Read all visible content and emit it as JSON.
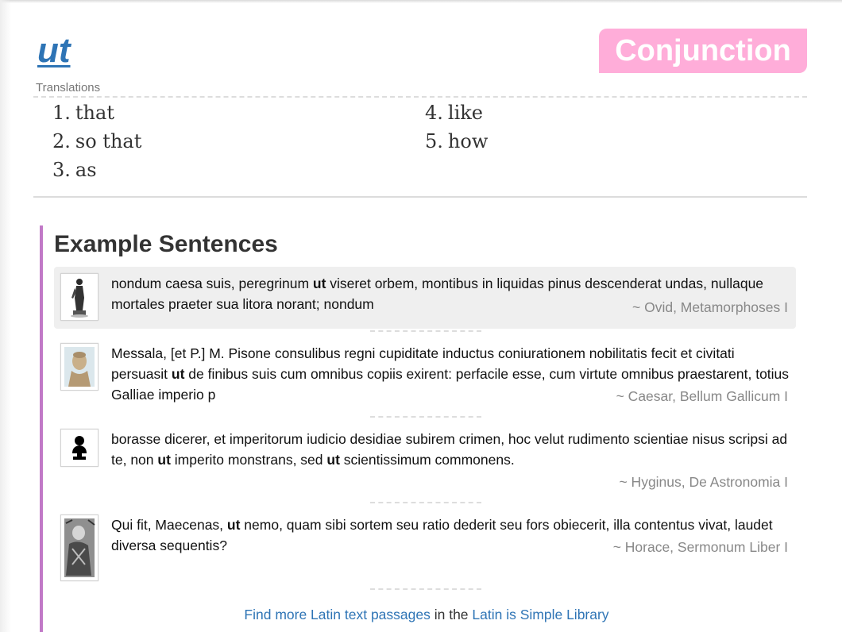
{
  "entry": {
    "word": "ut",
    "part_of_speech": "Conjunction",
    "translations_label": "Translations",
    "translations": [
      {
        "num": "1.",
        "text": "that"
      },
      {
        "num": "2.",
        "text": "so that"
      },
      {
        "num": "3.",
        "text": "as"
      },
      {
        "num": "4.",
        "text": "like"
      },
      {
        "num": "5.",
        "text": "how"
      }
    ]
  },
  "examples": {
    "title": "Example Sentences",
    "items": [
      {
        "thumb_icon": "statue-icon",
        "parts": [
          {
            "t": "nondum caesa suis, peregrinum ",
            "b": false
          },
          {
            "t": "ut",
            "b": true
          },
          {
            "t": " viseret orbem, montibus in liquidas pinus descenderat undas, nullaque mortales praeter sua litora norant; nondum",
            "b": false
          }
        ],
        "attribution": "~ Ovid, Metamorphoses I"
      },
      {
        "thumb_icon": "bust-photo-icon",
        "parts": [
          {
            "t": "Messala, [et P.] M. Pisone consulibus regni cupiditate inductus coniurationem nobilitatis fecit et civitati persuasit ",
            "b": false
          },
          {
            "t": "ut",
            "b": true
          },
          {
            "t": " de finibus suis cum omnibus copiis exirent: perfacile esse, cum virtute omnibus praestarent, totius Galliae imperio p",
            "b": false
          }
        ],
        "attribution": "~ Caesar, Bellum Gallicum I"
      },
      {
        "thumb_icon": "bust-silhouette-icon",
        "parts": [
          {
            "t": "borasse dicerer, et imperitorum iudicio desidiae subirem crimen, hoc velut rudimento scientiae nisus scripsi ad te, non ",
            "b": false
          },
          {
            "t": "ut",
            "b": true
          },
          {
            "t": " imperito monstrans, sed ",
            "b": false
          },
          {
            "t": "ut",
            "b": true
          },
          {
            "t": " scientissimum commonens.",
            "b": false
          }
        ],
        "attribution": "~ Hyginus, De Astronomia I"
      },
      {
        "thumb_icon": "engraved-portrait-icon",
        "parts": [
          {
            "t": "Qui fit, Maecenas, ",
            "b": false
          },
          {
            "t": "ut",
            "b": true
          },
          {
            "t": " nemo, quam sibi sortem seu ratio dederit seu fors obiecerit, illa contentus vivat, laudet diversa sequentis?",
            "b": false
          }
        ],
        "attribution": "~ Horace, Sermonum Liber I"
      }
    ]
  },
  "footer": {
    "link1": "Find more Latin text passages",
    "middle": " in the ",
    "link2": "Latin is Simple Library"
  },
  "colors": {
    "link": "#2e74b5",
    "badge": "#ffadd9",
    "accent_border": "#c179c7",
    "highlight_bg": "#efefef"
  }
}
